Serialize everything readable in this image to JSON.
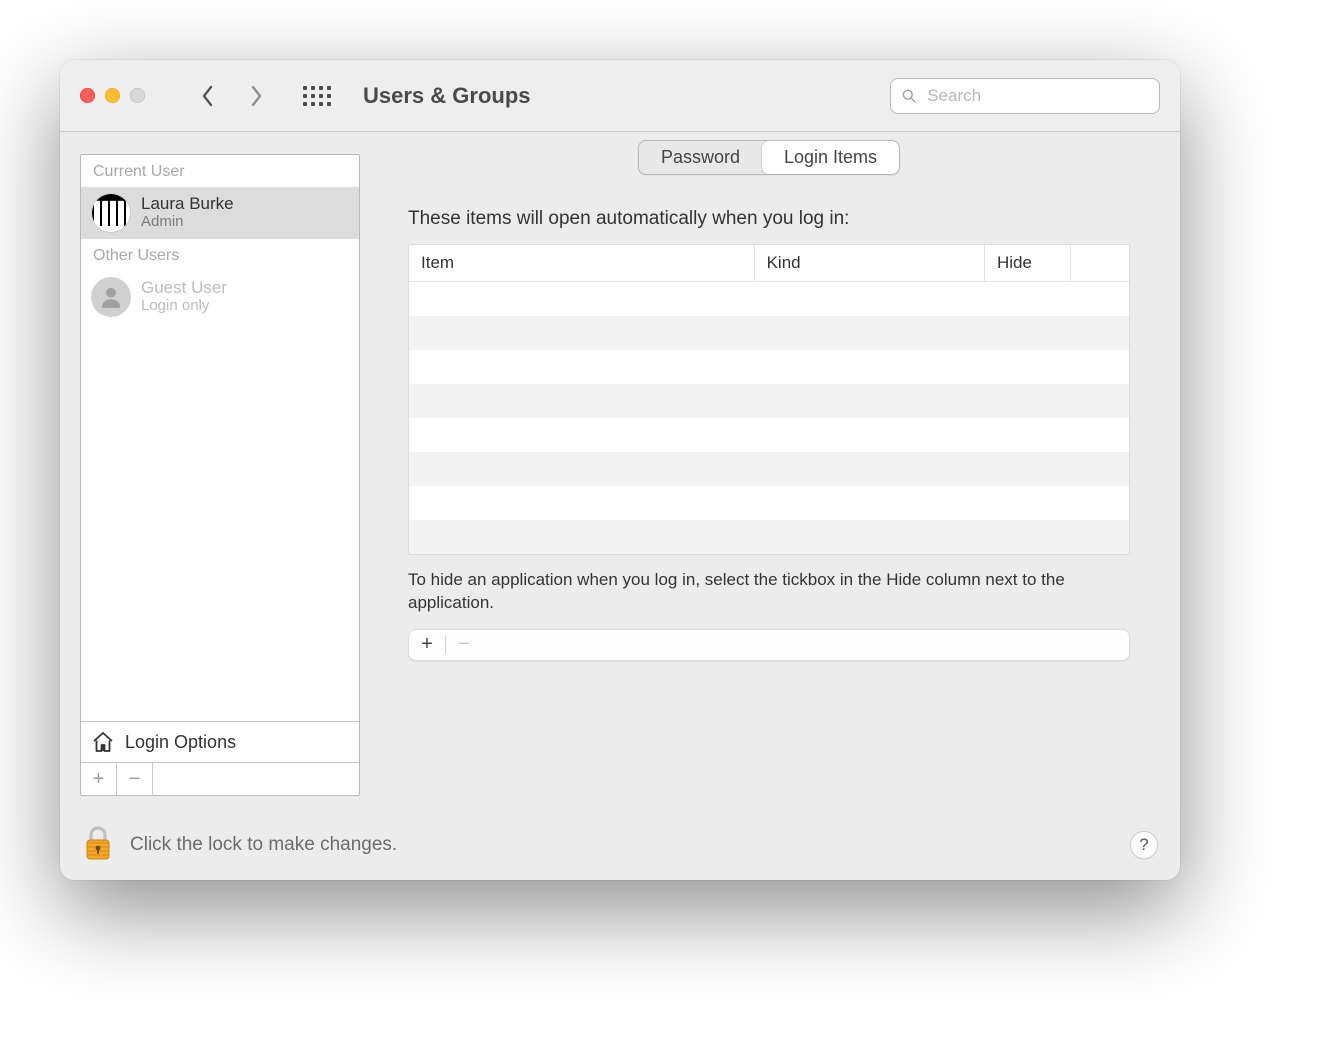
{
  "window": {
    "title": "Users & Groups"
  },
  "search": {
    "placeholder": "Search"
  },
  "sidebar": {
    "current_label": "Current User",
    "other_label": "Other Users",
    "current_user": {
      "name": "Laura Burke",
      "role": "Admin"
    },
    "other_users": [
      {
        "name": "Guest User",
        "role": "Login only"
      }
    ],
    "login_options_label": "Login Options"
  },
  "tabs": {
    "password": "Password",
    "login_items": "Login Items",
    "active": "login_items"
  },
  "main": {
    "intro": "These items will open automatically when you log in:",
    "columns": {
      "item": "Item",
      "kind": "Kind",
      "hide": "Hide"
    },
    "rows": [],
    "hint": "To hide an application when you log in, select the tickbox in the Hide column next to the application."
  },
  "footer": {
    "lock_text": "Click the lock to make changes.",
    "help": "?"
  }
}
